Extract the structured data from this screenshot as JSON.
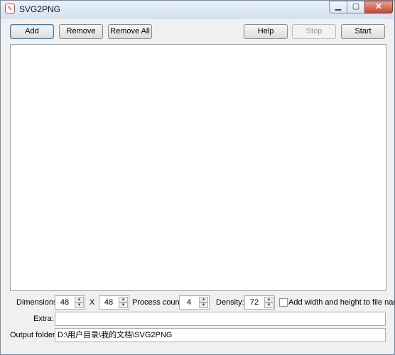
{
  "window": {
    "title": "SVG2PNG"
  },
  "toolbar": {
    "add": "Add",
    "remove": "Remove",
    "remove_all": "Remove All",
    "help": "Help",
    "stop": "Stop",
    "start": "Start"
  },
  "file_list": {
    "items": []
  },
  "options": {
    "dimensions_label": "Dimensions:",
    "width": "48",
    "x_label": "X",
    "height": "48",
    "process_count_label": "Process count:",
    "process_count": "4",
    "density_label": "Density:",
    "density": "72",
    "add_size_label": "Add width and height to file name",
    "add_size_checked": false,
    "extra_label": "Extra:",
    "extra_value": "",
    "output_folder_label": "Output folder:",
    "output_folder_value": "D:\\用户目录\\我的文档\\SVG2PNG"
  }
}
